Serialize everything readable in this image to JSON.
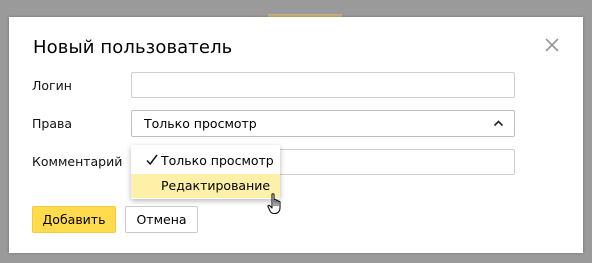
{
  "dialog": {
    "title": "Новый пользователь",
    "close_icon": "close-icon"
  },
  "form": {
    "login": {
      "label": "Логин",
      "value": "",
      "placeholder": ""
    },
    "rights": {
      "label": "Права",
      "selected": "Только просмотр",
      "options": [
        "Только просмотр",
        "Редактирование"
      ],
      "highlighted_option": "Редактирование"
    },
    "comment": {
      "label": "Комментарий",
      "value": "",
      "placeholder": ""
    }
  },
  "buttons": {
    "add": "Добавить",
    "cancel": "Отмена"
  },
  "colors": {
    "primary_button": "#ffdb4d",
    "hover_item": "#fff0a8",
    "overlay": "#9a9a9a"
  }
}
